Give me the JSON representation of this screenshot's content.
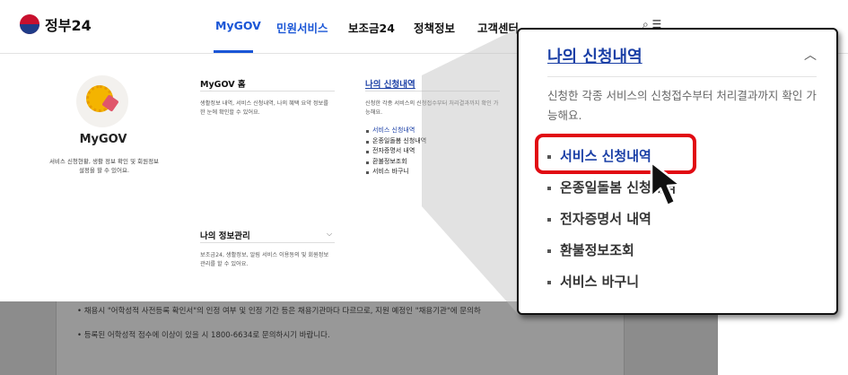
{
  "header": {
    "logo_text": "정부24",
    "nav": [
      {
        "label": "MyGOV"
      },
      {
        "label": "민원서비스"
      },
      {
        "label": "보조금24"
      },
      {
        "label": "정책정보"
      },
      {
        "label": "고객센터"
      }
    ]
  },
  "mega_menu": {
    "mygov": {
      "title": "MyGOV",
      "desc": "서비스 신청현황, 생활 정보 확인 및 회원정보 설정을 할 수 있어요."
    },
    "mygov_home": {
      "title": "MyGOV 홈",
      "desc": "생활정보 내역, 서비스 신청내역, 나의 혜택 요약 정보를 한 눈에 확인할 수 있어요."
    },
    "my_info": {
      "title": "나의 정보관리",
      "desc": "보조금24, 생활정보, 알림 서비스 이용동의 및 회원정보 관리를 할 수 있어요."
    },
    "my_applications": {
      "title": "나의 신청내역",
      "desc": "신청한 각종 서비스의 신청접수부터 처리결과까지 확인 가능해요.",
      "items": [
        {
          "label": "서비스 신청내역"
        },
        {
          "label": "온종일돌봄 신청내역"
        },
        {
          "label": "전자증명서 내역"
        },
        {
          "label": "환불정보조회"
        },
        {
          "label": "서비스 바구니"
        }
      ]
    }
  },
  "background_page": {
    "line1": "• 채용시 \"어학성적 사전등록 확인서\"의 인정 여부 및 인정 기간 등은 채용기관마다 다르므로, 지원 예정인 \"채용기관\"에 문의하",
    "line2": "• 등록된 어학성적 점수에 이상이 있을 시 1800-6634로 문의하시기 바랍니다."
  },
  "zoom": {
    "title": "나의 신청내역",
    "desc": "신청한 각종 서비스의 신청접수부터 처리결과까지 확인 가능해요.",
    "items": [
      {
        "label": "서비스 신청내역"
      },
      {
        "label": "온종일돌봄 신청내역"
      },
      {
        "label": "전자증명서 내역"
      },
      {
        "label": "환불정보조회"
      },
      {
        "label": "서비스 바구니"
      }
    ]
  },
  "colors": {
    "accent": "#1a56d6",
    "link": "#1a3fa6",
    "highlight_box": "#e10a12"
  },
  "icons": [
    "government-logo-icon",
    "mygov-gear-icon",
    "chevron-up-icon",
    "chevron-down-icon",
    "search-icon",
    "menu-icon",
    "mouse-pointer-icon"
  ]
}
